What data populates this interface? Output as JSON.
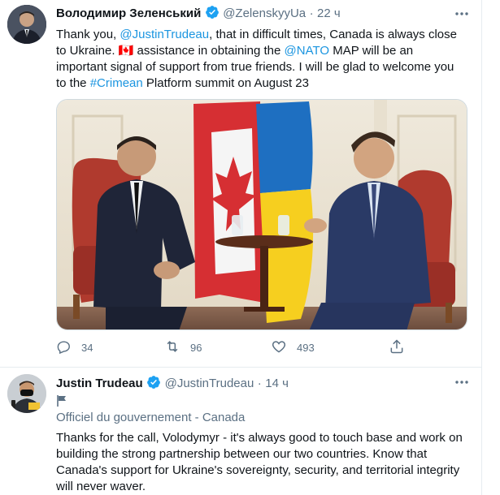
{
  "tweet1": {
    "author_name": "Володимир Зеленський",
    "handle": "@ZelenskyyUa",
    "dot": "·",
    "time": "22 ч",
    "text": {
      "t1": "Thank you, ",
      "mention1": "@JustinTrudeau",
      "t2": ", that in difficult times, Canada is always close to Ukraine. ",
      "flag": "🇨🇦",
      "t3": " assistance in obtaining the ",
      "mention2": "@NATO",
      "t4": " MAP will be an important signal of support from true friends. I will be glad to welcome you to the ",
      "hashtag": "#Crimean",
      "t5": " Platform summit on August 23"
    },
    "actions": {
      "reply_count": "34",
      "retweet_count": "96",
      "like_count": "493"
    }
  },
  "tweet2": {
    "author_name": "Justin Trudeau",
    "handle": "@JustinTrudeau",
    "dot": "·",
    "time": "14 ч",
    "label": "Officiel du gouvernement - Canada",
    "text": "Thanks for the call, Volodymyr - it's always good to touch base and work on building the strong partnership between our two countries. Know that Canada's support for Ukraine's sovereignty, security, and territorial integrity will never waver."
  },
  "colors": {
    "accent": "#1b95e0",
    "verified": "#1da1f2",
    "secondary_text": "#5b7083",
    "divider": "#e6ecf0"
  },
  "icons": [
    "more-icon",
    "verified-icon",
    "reply-icon",
    "retweet-icon",
    "like-icon",
    "share-icon",
    "government-flag-icon"
  ]
}
